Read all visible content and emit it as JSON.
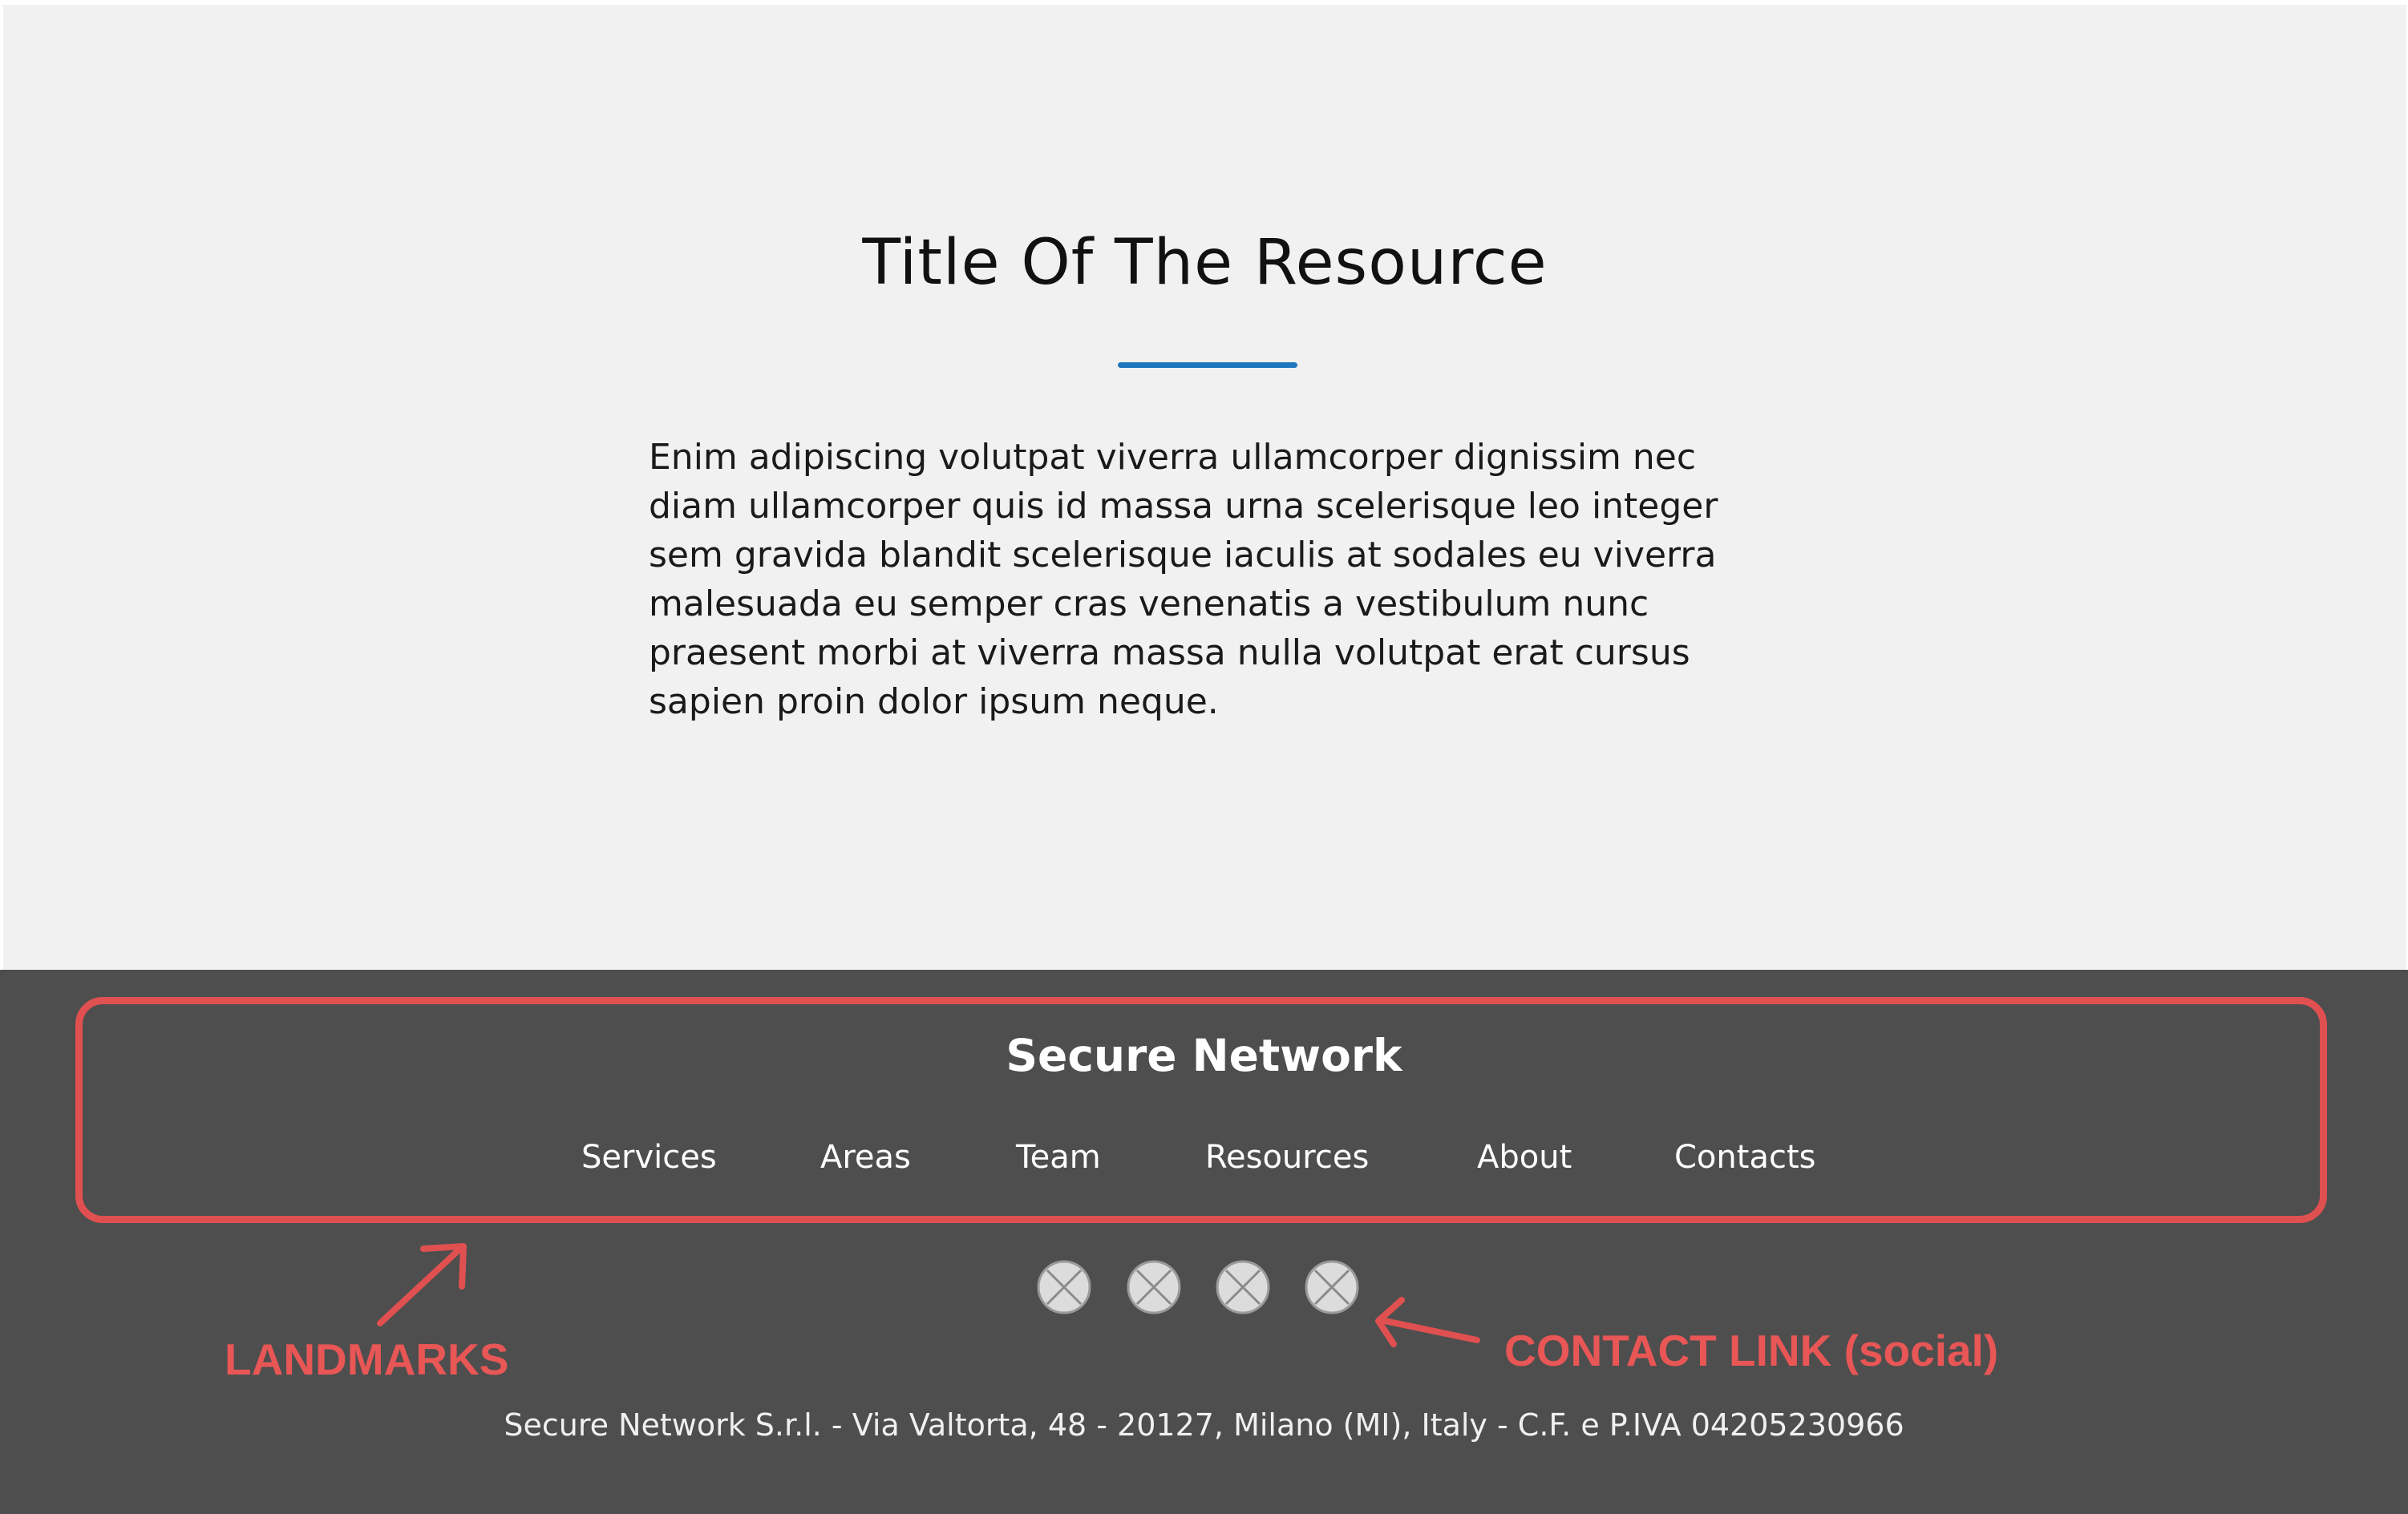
{
  "resource": {
    "title": "Title Of The Resource",
    "body": "Enim adipiscing volutpat viverra ullamcorper dignissim nec diam ullamcorper quis id massa urna scelerisque leo integer sem gravida blandit scelerisque iaculis at sodales eu viverra malesuada eu semper cras venenatis a vestibulum nunc praesent morbi at viverra massa nulla volutpat erat cursus sapien proin dolor ipsum neque."
  },
  "footer": {
    "brand": "Secure Network",
    "nav": [
      {
        "label": "Services"
      },
      {
        "label": "Areas"
      },
      {
        "label": "Team"
      },
      {
        "label": "Resources"
      },
      {
        "label": "About"
      },
      {
        "label": "Contacts"
      }
    ],
    "social_icons": [
      "social-icon-placeholder",
      "social-icon-placeholder",
      "social-icon-placeholder",
      "social-icon-placeholder"
    ],
    "copyright": "Secure Network S.r.l. - Via Valtorta, 48 - 20127, Milano (MI), Italy - C.F. e P.IVA 04205230966"
  },
  "annotations": {
    "landmarks": "LANDMARKS",
    "contact_link": "CONTACT LINK (social)"
  },
  "colors": {
    "accent_blue": "#1f77bf",
    "annotation_red": "#e05050",
    "footer_bg": "#4e4e4e",
    "main_bg": "#f0f1f0"
  }
}
